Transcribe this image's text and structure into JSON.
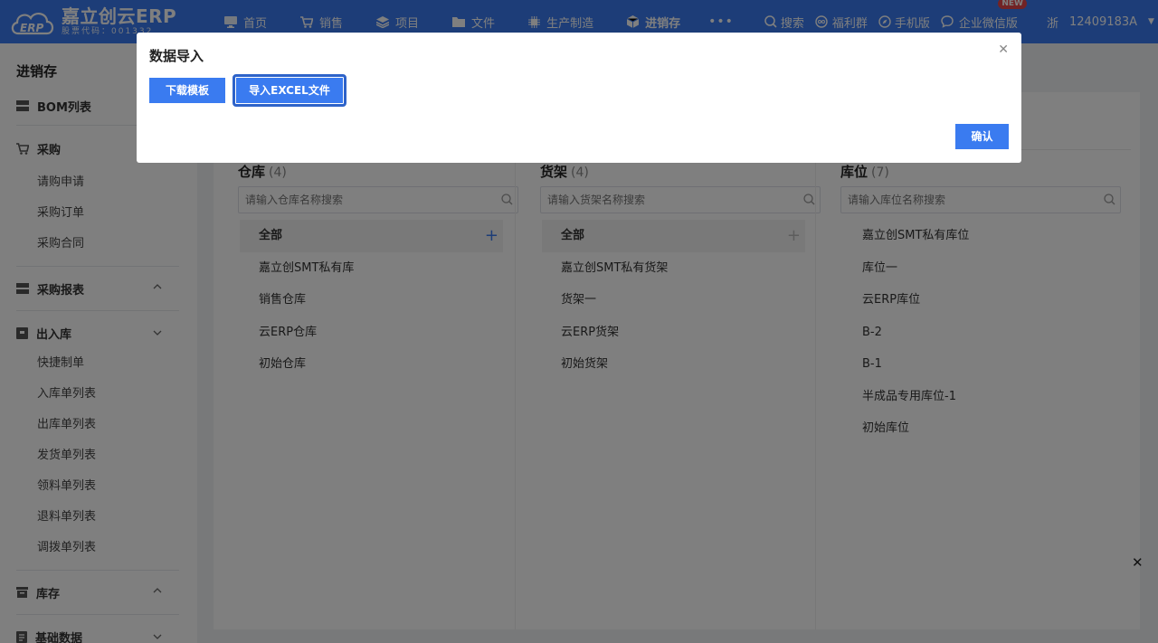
{
  "header": {
    "brand": "嘉立创云ERP",
    "stock_code": "股票代码：001332",
    "nav": [
      {
        "label": "首页",
        "icon": "monitor-icon"
      },
      {
        "label": "销售",
        "icon": "cart-icon"
      },
      {
        "label": "项目",
        "icon": "layers-icon"
      },
      {
        "label": "文件",
        "icon": "folder-icon"
      },
      {
        "label": "生产制造",
        "icon": "chip-icon"
      },
      {
        "label": "进销存",
        "icon": "cube-icon"
      }
    ],
    "more": "•••",
    "tools": {
      "search": "搜索",
      "welfare": "福利群",
      "mobile": "手机版",
      "wechat": "企业微信版",
      "new_badge": "NEW"
    },
    "region": "浙",
    "account": "12409183A"
  },
  "sidebar": {
    "title": "进销存",
    "bom": "BOM列表",
    "purchase": "采购",
    "purchase_items": [
      "请购申请",
      "采购订单",
      "采购合同"
    ],
    "purchase_report": "采购报表",
    "inout": "出入库",
    "inout_items": [
      "快捷制单",
      "入库单列表",
      "出库单列表",
      "发货单列表",
      "领料单列表",
      "退料单列表",
      "调拨单列表"
    ],
    "stock": "库存",
    "basic": "基础数据"
  },
  "columns": {
    "warehouse": {
      "title": "仓库",
      "count": "(4)",
      "placeholder": "请输入仓库名称搜索",
      "all": "全部",
      "items": [
        "嘉立创SMT私有库",
        "销售仓库",
        "云ERP仓库",
        "初始仓库"
      ]
    },
    "shelf": {
      "title": "货架",
      "count": "(4)",
      "placeholder": "请输入货架名称搜索",
      "all": "全部",
      "items": [
        "嘉立创SMT私有货架",
        "货架一",
        "云ERP货架",
        "初始货架"
      ]
    },
    "location": {
      "title": "库位",
      "count": "(7)",
      "placeholder": "请输入库位名称搜索",
      "items": [
        "嘉立创SMT私有库位",
        "库位一",
        "云ERP库位",
        "B-2",
        "B-1",
        "半成品专用库位-1",
        "初始库位"
      ]
    }
  },
  "dialog": {
    "title": "数据导入",
    "download_label": "下载模板",
    "import_label": "导入EXCEL文件",
    "confirm_label": "确认"
  },
  "colors": {
    "primary": "#3a7bf0",
    "badge": "#e5474b"
  }
}
